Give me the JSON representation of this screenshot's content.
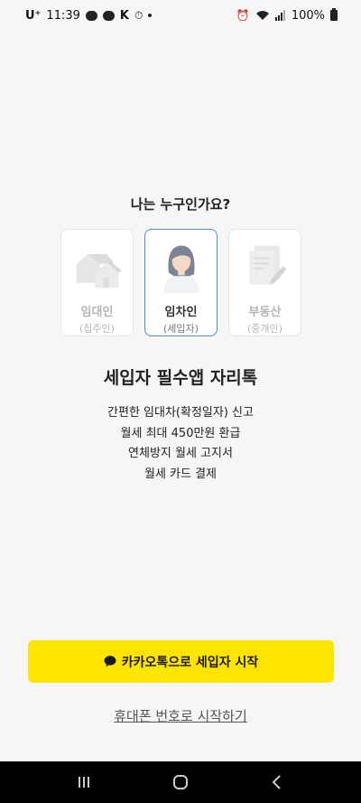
{
  "status_bar": {
    "carrier": "U⁺",
    "time": "11:39",
    "battery": "100%"
  },
  "question": "나는 누구인가요?",
  "roles": [
    {
      "title": "임대인",
      "subtitle": "(집주인)",
      "icon": "houses-icon",
      "selected": false
    },
    {
      "title": "임차인",
      "subtitle": "(세입자)",
      "icon": "tenant-avatar-icon",
      "selected": true
    },
    {
      "title": "부동산",
      "subtitle": "(중개인)",
      "icon": "documents-icon",
      "selected": false
    }
  ],
  "headline": "세입자 필수앱 자리톡",
  "features": [
    "간편한 임대차(확정일자) 신고",
    "월세 최대 450만원 환급",
    "연체방지 월세 고지서",
    "월세 카드 결제"
  ],
  "kakao_button": {
    "label": "카카오톡으로 세입자 시작",
    "icon": "speech-bubble-icon",
    "color": "#fee500"
  },
  "phone_link": "휴대폰 번호로 시작하기",
  "accent_border": "#4a90d9"
}
